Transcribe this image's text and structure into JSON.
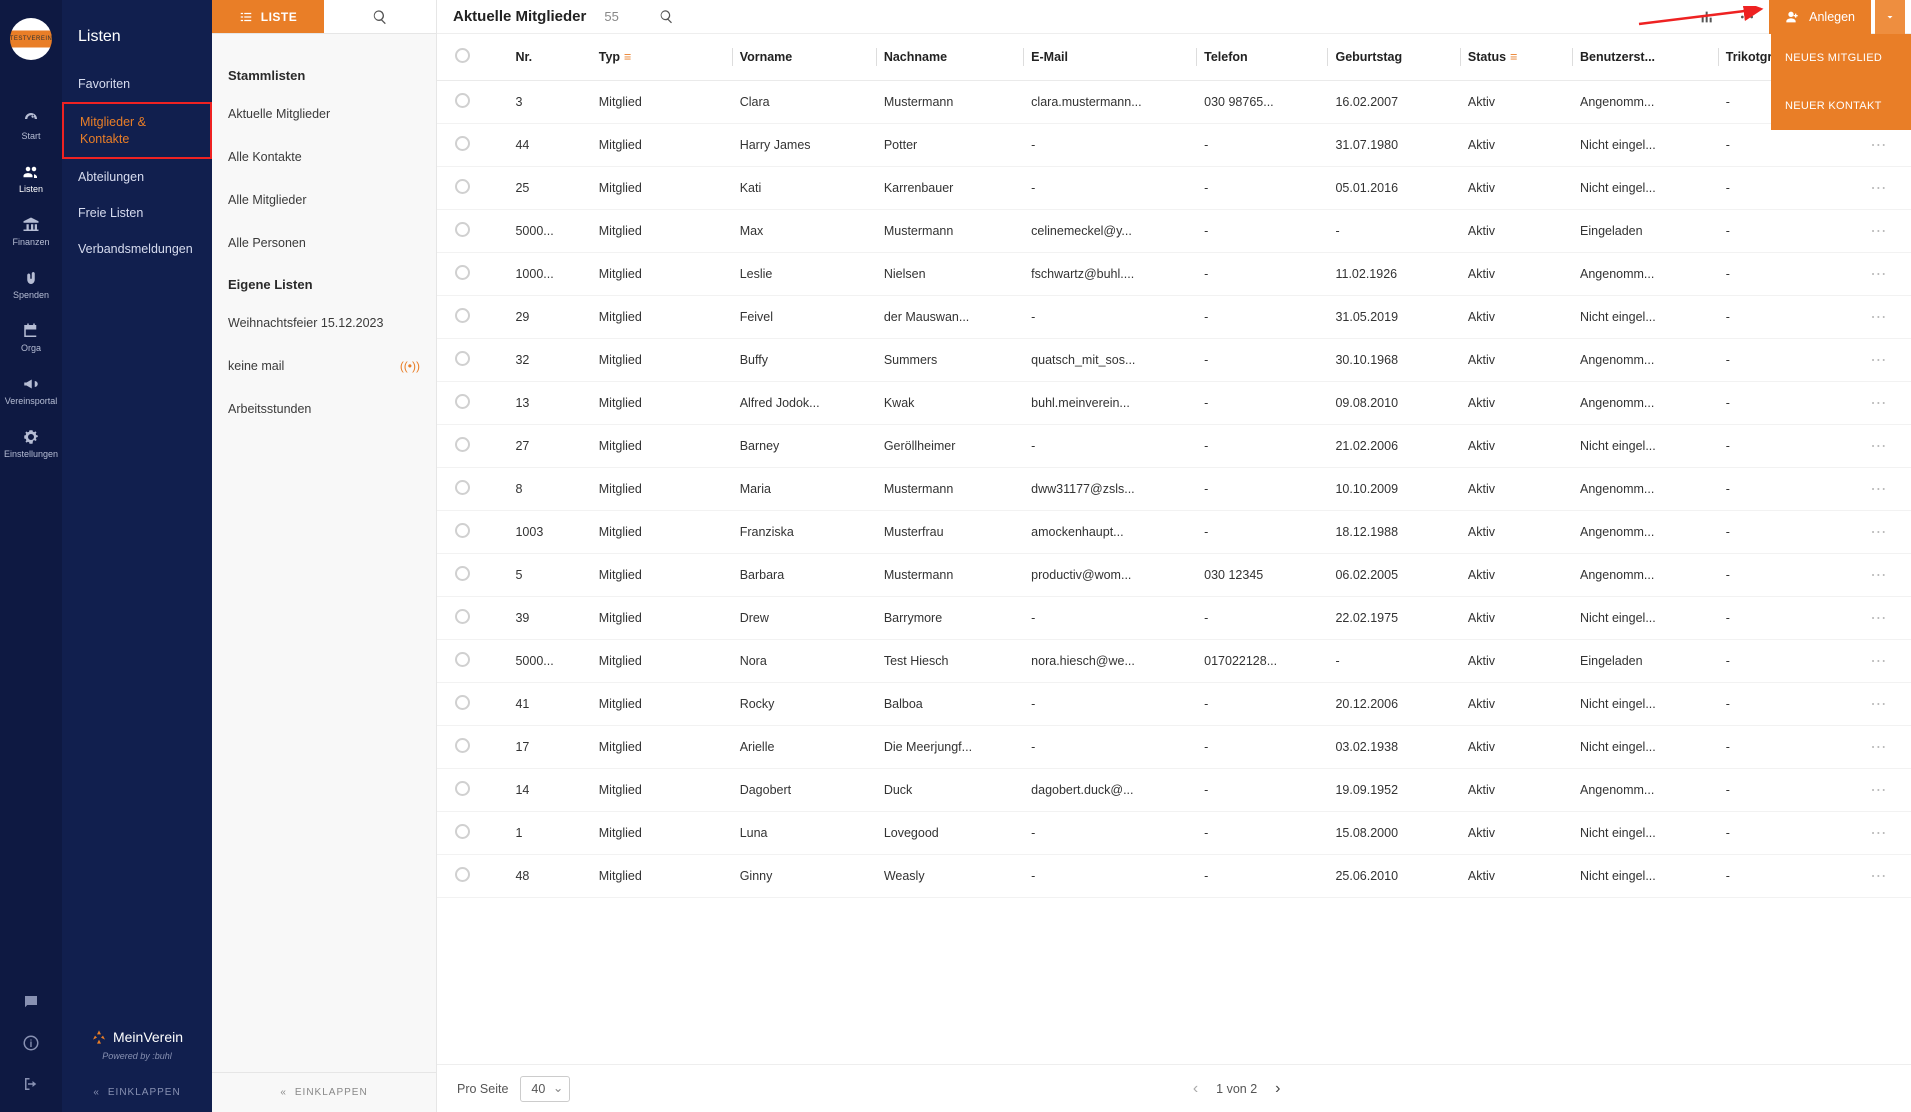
{
  "app": {
    "logo_text": "TESTVEREIN"
  },
  "rail": {
    "items": [
      {
        "label": "Start",
        "icon": "gauge"
      },
      {
        "label": "Listen",
        "icon": "users",
        "active": true
      },
      {
        "label": "Finanzen",
        "icon": "bank"
      },
      {
        "label": "Spenden",
        "icon": "hands"
      },
      {
        "label": "Orga",
        "icon": "calendar"
      },
      {
        "label": "Vereinsportal",
        "icon": "megaphone"
      },
      {
        "label": "Einstellungen",
        "icon": "gear"
      }
    ]
  },
  "panel2": {
    "title": "Listen",
    "items": [
      {
        "label": "Favoriten"
      },
      {
        "label": "Mitglieder & Kontakte",
        "highlighted": true
      },
      {
        "label": "Abteilungen"
      },
      {
        "label": "Freie Listen"
      },
      {
        "label": "Verbandsmeldungen"
      }
    ],
    "brand": "MeinVerein",
    "powered": "Powered by :buhl",
    "collapse": "EINKLAPPEN"
  },
  "panel3": {
    "tab_liste": "LISTE",
    "sections": [
      {
        "title": "Stammlisten",
        "items": [
          {
            "label": "Aktuelle Mitglieder"
          },
          {
            "label": "Alle Kontakte"
          },
          {
            "label": "Alle Mitglieder"
          },
          {
            "label": "Alle Personen"
          }
        ]
      },
      {
        "title": "Eigene Listen",
        "items": [
          {
            "label": "Weihnachtsfeier 15.12.2023"
          },
          {
            "label": "keine mail",
            "live": true
          },
          {
            "label": "Arbeitsstunden"
          }
        ]
      }
    ],
    "collapse": "EINKLAPPEN"
  },
  "main": {
    "title": "Aktuelle Mitglieder",
    "count": "55",
    "anlegen_label": "Anlegen",
    "dropdown": [
      {
        "label": "NEUES MITGLIED"
      },
      {
        "label": "NEUER KONTAKT"
      }
    ]
  },
  "table": {
    "columns": [
      "Nr.",
      "Typ",
      "Vorname",
      "Nachname",
      "E-Mail",
      "Telefon",
      "Geburtstag",
      "Status",
      "Benutzerst...",
      "Trikotgrö..."
    ],
    "rows": [
      {
        "nr": "3",
        "typ": "Mitglied",
        "vor": "Clara",
        "nach": "Mustermann",
        "email": "clara.mustermann...",
        "tel": "030 98765...",
        "geb": "16.02.2007",
        "stat": "Aktiv",
        "ben": "Angenomm...",
        "tri": "-"
      },
      {
        "nr": "44",
        "typ": "Mitglied",
        "vor": "Harry James",
        "nach": "Potter",
        "email": "-",
        "tel": "-",
        "geb": "31.07.1980",
        "stat": "Aktiv",
        "ben": "Nicht eingel...",
        "tri": "-"
      },
      {
        "nr": "25",
        "typ": "Mitglied",
        "vor": "Kati",
        "nach": "Karrenbauer",
        "email": "-",
        "tel": "-",
        "geb": "05.01.2016",
        "stat": "Aktiv",
        "ben": "Nicht eingel...",
        "tri": "-"
      },
      {
        "nr": "5000...",
        "typ": "Mitglied",
        "vor": "Max",
        "nach": "Mustermann",
        "email": "celinemeckel@y...",
        "tel": "-",
        "geb": "-",
        "stat": "Aktiv",
        "ben": "Eingeladen",
        "tri": "-"
      },
      {
        "nr": "1000...",
        "typ": "Mitglied",
        "vor": "Leslie",
        "nach": "Nielsen",
        "email": "fschwartz@buhl....",
        "tel": "-",
        "geb": "11.02.1926",
        "stat": "Aktiv",
        "ben": "Angenomm...",
        "tri": "-"
      },
      {
        "nr": "29",
        "typ": "Mitglied",
        "vor": "Feivel",
        "nach": "der Mauswan...",
        "email": "-",
        "tel": "-",
        "geb": "31.05.2019",
        "stat": "Aktiv",
        "ben": "Nicht eingel...",
        "tri": "-"
      },
      {
        "nr": "32",
        "typ": "Mitglied",
        "vor": "Buffy",
        "nach": "Summers",
        "email": "quatsch_mit_sos...",
        "tel": "-",
        "geb": "30.10.1968",
        "stat": "Aktiv",
        "ben": "Angenomm...",
        "tri": "-"
      },
      {
        "nr": "13",
        "typ": "Mitglied",
        "vor": "Alfred Jodok...",
        "nach": "Kwak",
        "email": "buhl.meinverein...",
        "tel": "-",
        "geb": "09.08.2010",
        "stat": "Aktiv",
        "ben": "Angenomm...",
        "tri": "-"
      },
      {
        "nr": "27",
        "typ": "Mitglied",
        "vor": "Barney",
        "nach": "Geröllheimer",
        "email": "-",
        "tel": "-",
        "geb": "21.02.2006",
        "stat": "Aktiv",
        "ben": "Nicht eingel...",
        "tri": "-"
      },
      {
        "nr": "8",
        "typ": "Mitglied",
        "vor": "Maria",
        "nach": "Mustermann",
        "email": "dww31177@zsls...",
        "tel": "-",
        "geb": "10.10.2009",
        "stat": "Aktiv",
        "ben": "Angenomm...",
        "tri": "-"
      },
      {
        "nr": "1003",
        "typ": "Mitglied",
        "vor": "Franziska",
        "nach": "Musterfrau",
        "email": "amockenhaupt...",
        "tel": "-",
        "geb": "18.12.1988",
        "stat": "Aktiv",
        "ben": "Angenomm...",
        "tri": "-"
      },
      {
        "nr": "5",
        "typ": "Mitglied",
        "vor": "Barbara",
        "nach": "Mustermann",
        "email": "productiv@wom...",
        "tel": "030 12345",
        "geb": "06.02.2005",
        "stat": "Aktiv",
        "ben": "Angenomm...",
        "tri": "-"
      },
      {
        "nr": "39",
        "typ": "Mitglied",
        "vor": "Drew",
        "nach": "Barrymore",
        "email": "-",
        "tel": "-",
        "geb": "22.02.1975",
        "stat": "Aktiv",
        "ben": "Nicht eingel...",
        "tri": "-"
      },
      {
        "nr": "5000...",
        "typ": "Mitglied",
        "vor": "Nora",
        "nach": "Test Hiesch",
        "email": "nora.hiesch@we...",
        "tel": "017022128...",
        "geb": "-",
        "stat": "Aktiv",
        "ben": "Eingeladen",
        "tri": "-"
      },
      {
        "nr": "41",
        "typ": "Mitglied",
        "vor": "Rocky",
        "nach": "Balboa",
        "email": "-",
        "tel": "-",
        "geb": "20.12.2006",
        "stat": "Aktiv",
        "ben": "Nicht eingel...",
        "tri": "-"
      },
      {
        "nr": "17",
        "typ": "Mitglied",
        "vor": "Arielle",
        "nach": "Die Meerjungf...",
        "email": "-",
        "tel": "-",
        "geb": "03.02.1938",
        "stat": "Aktiv",
        "ben": "Nicht eingel...",
        "tri": "-"
      },
      {
        "nr": "14",
        "typ": "Mitglied",
        "vor": "Dagobert",
        "nach": "Duck",
        "email": "dagobert.duck@...",
        "tel": "-",
        "geb": "19.09.1952",
        "stat": "Aktiv",
        "ben": "Angenomm...",
        "tri": "-"
      },
      {
        "nr": "1",
        "typ": "Mitglied",
        "vor": "Luna",
        "nach": "Lovegood",
        "email": "-",
        "tel": "-",
        "geb": "15.08.2000",
        "stat": "Aktiv",
        "ben": "Nicht eingel...",
        "tri": "-"
      },
      {
        "nr": "48",
        "typ": "Mitglied",
        "vor": "Ginny",
        "nach": "Weasly",
        "email": "-",
        "tel": "-",
        "geb": "25.06.2010",
        "stat": "Aktiv",
        "ben": "Nicht eingel...",
        "tri": "-"
      }
    ]
  },
  "pagination": {
    "per_page_label": "Pro Seite",
    "per_page_value": "40",
    "page_info": "1 von 2"
  }
}
